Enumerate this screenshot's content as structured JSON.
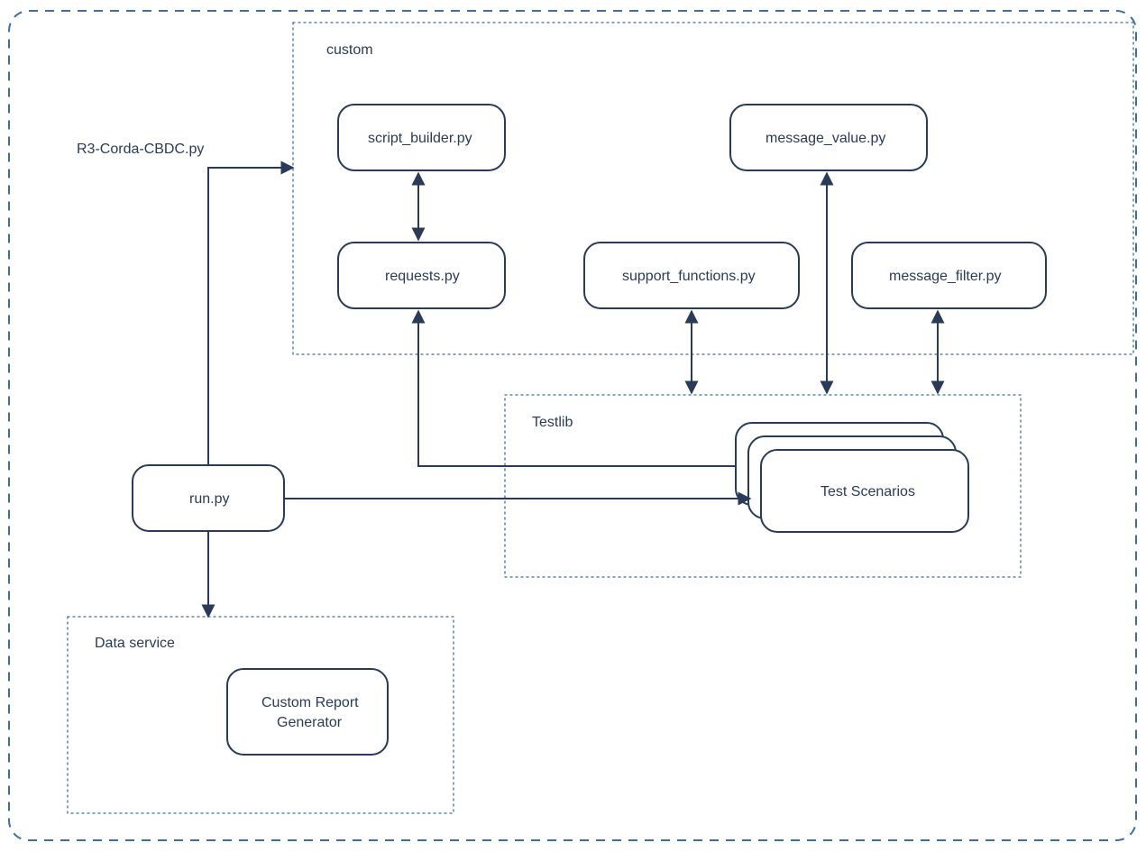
{
  "outer_label": "R3-Corda-CBDC.py",
  "groups": {
    "custom": "custom",
    "testlib": "Testlib",
    "dataservice": "Data service"
  },
  "nodes": {
    "run": "run.py",
    "script_builder": "script_builder.py",
    "requests": "requests.py",
    "support_functions": "support_functions.py",
    "message_value": "message_value.py",
    "message_filter": "message_filter.py",
    "test_scenarios": "Test Scenarios",
    "report_gen_l1": "Custom Report",
    "report_gen_l2": "Generator"
  }
}
